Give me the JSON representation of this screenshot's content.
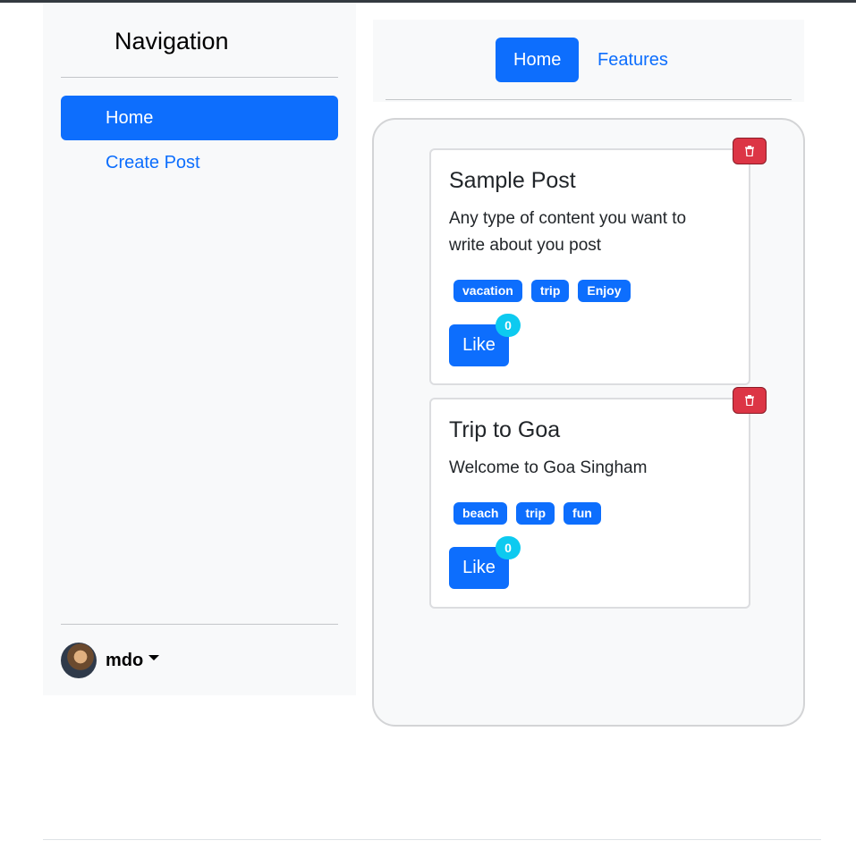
{
  "sidebar": {
    "title": "Navigation",
    "items": [
      {
        "label": "Home",
        "active": true
      },
      {
        "label": "Create Post",
        "active": false
      }
    ],
    "user": {
      "name": "mdo"
    }
  },
  "header": {
    "tabs": [
      {
        "label": "Home",
        "active": true
      },
      {
        "label": "Features",
        "active": false
      }
    ]
  },
  "posts": [
    {
      "title": "Sample Post",
      "body": "Any type of content you want to write about you post",
      "tags": [
        "vacation",
        "trip",
        "Enjoy"
      ],
      "like_label": "Like",
      "likes": "0"
    },
    {
      "title": "Trip to Goa",
      "body": "Welcome to Goa Singham",
      "tags": [
        "beach",
        "trip",
        "fun"
      ],
      "like_label": "Like",
      "likes": "0"
    }
  ],
  "colors": {
    "primary": "#0d6efd",
    "danger": "#dc3545",
    "info": "#0dcaf0",
    "sidebar_bg": "#f8f9fa"
  },
  "icons": {
    "delete": "trash-icon",
    "caret": "caret-down-icon"
  }
}
